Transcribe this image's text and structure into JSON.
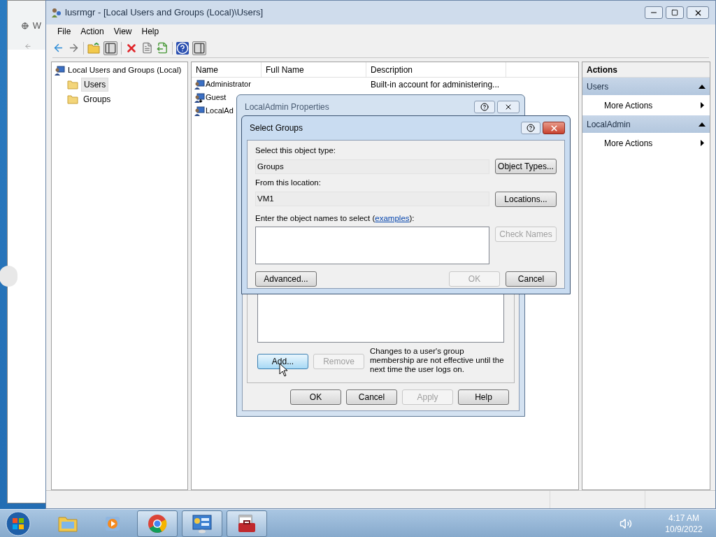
{
  "background_window": {
    "tab_text": "W"
  },
  "window": {
    "title": "lusrmgr - [Local Users and Groups (Local)\\Users]",
    "menu": [
      "File",
      "Action",
      "View",
      "Help"
    ]
  },
  "tree": {
    "label": "Local Users and Groups (Local)",
    "children": [
      {
        "label": "Users",
        "selected": true
      },
      {
        "label": "Groups",
        "selected": false
      }
    ]
  },
  "list": {
    "columns": [
      "Name",
      "Full Name",
      "Description"
    ],
    "rows": [
      {
        "name": "Administrator",
        "description": "Built-in account for administering...",
        "disabled": false
      },
      {
        "name": "Guest",
        "disabled": true
      },
      {
        "name": "LocalAd",
        "disabled": false
      }
    ]
  },
  "actions": {
    "title": "Actions",
    "sections": [
      {
        "label": "Users",
        "expanded": true,
        "items": [
          "More Actions"
        ]
      },
      {
        "label": "LocalAdmin",
        "expanded": true,
        "items": [
          "More Actions"
        ]
      }
    ]
  },
  "properties_dialog": {
    "title": "LocalAdmin Properties",
    "note": "Changes to a user's group membership are not effective until the next time the user logs on.",
    "buttons": [
      {
        "label": "Add...",
        "disabled": false,
        "hovered": true
      },
      {
        "label": "Remove",
        "disabled": true,
        "hovered": false
      }
    ],
    "footer_buttons": [
      {
        "label": "OK",
        "disabled": false
      },
      {
        "label": "Cancel",
        "disabled": false
      },
      {
        "label": "Apply",
        "disabled": true
      },
      {
        "label": "Help",
        "disabled": false
      }
    ]
  },
  "select_dialog": {
    "title": "Select Groups",
    "object_type_label": "Select this object type:",
    "object_type": "Groups",
    "object_types_button": "Object Types...",
    "location_label": "From this location:",
    "location": "VM1",
    "locations_button": "Locations...",
    "names_label_before": "Enter the object names to select (",
    "names_link": "examples",
    "names_label_after": "):",
    "check_names": {
      "label": "Check Names",
      "disabled": true
    },
    "advanced_button": "Advanced...",
    "ok": {
      "label": "OK",
      "disabled": true
    },
    "cancel": {
      "label": "Cancel",
      "disabled": false
    }
  },
  "taskbar": {
    "apps": [
      {
        "kind": "explorer",
        "running": false
      },
      {
        "kind": "media",
        "running": false
      },
      {
        "kind": "chrome",
        "running": true
      },
      {
        "kind": "control",
        "running": true
      },
      {
        "kind": "toolbox",
        "running": true
      }
    ],
    "time": "4:17 AM",
    "date": "10/9/2022"
  }
}
